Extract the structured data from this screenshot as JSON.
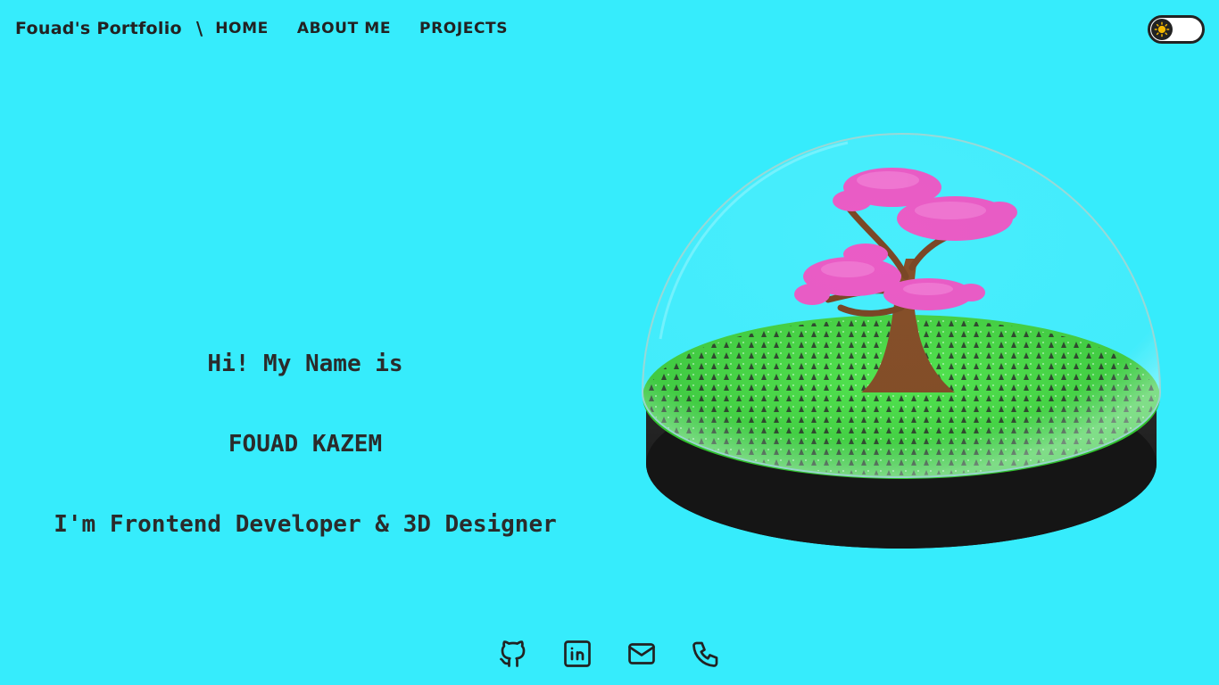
{
  "header": {
    "brand": "Fouad's Portfolio",
    "separator": "\\",
    "nav": [
      {
        "label": "HOME"
      },
      {
        "label": "ABOUT ME"
      },
      {
        "label": "PROJECTS"
      }
    ]
  },
  "theme_toggle": {
    "icon": "sun-icon",
    "state": "light"
  },
  "hero": {
    "line1": "Hi! My Name is",
    "line2": "FOUAD KAZEM",
    "line3": "I'm Frontend Developer & 3D Designer"
  },
  "social": [
    {
      "icon": "github-icon"
    },
    {
      "icon": "linkedin-icon"
    },
    {
      "icon": "mail-icon"
    },
    {
      "icon": "phone-icon"
    }
  ],
  "colors": {
    "background": "#36ecfc",
    "text": "#222222",
    "blossom": "#e94cc0",
    "grass": "#3fd93c"
  }
}
